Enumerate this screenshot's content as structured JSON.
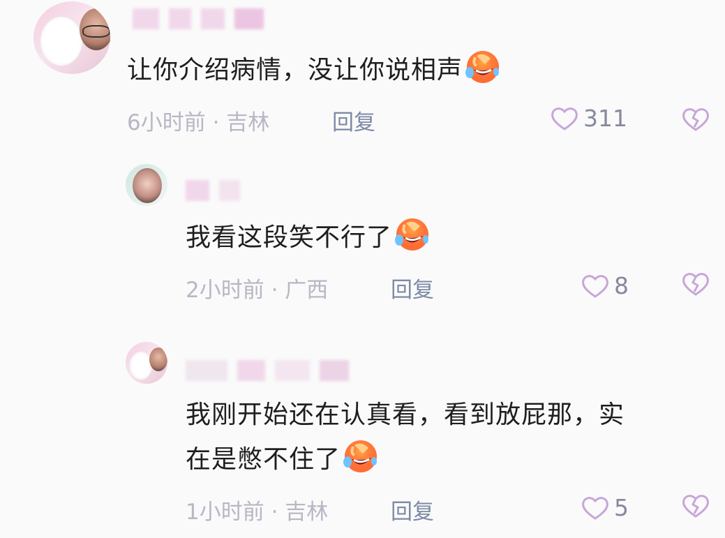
{
  "colors": {
    "background": "#fafafa",
    "text": "#1e1e1e",
    "meta": "#b7b7c5",
    "reply": "#7d8aa6",
    "heart": "#c7a6d8"
  },
  "icons": [
    "laughing-emoji-icon",
    "heart-icon",
    "broken-heart-icon"
  ],
  "comments": [
    {
      "text": "让你介绍病情，没让你说相声",
      "time_location": "6小时前 · 吉林",
      "reply_label": "回复",
      "likes": "311"
    },
    {
      "text": "我看这段笑不行了",
      "time_location": "2小时前 · 广西",
      "reply_label": "回复",
      "likes": "8"
    },
    {
      "text_line1": "我刚开始还在认真看，看到放屁那，实",
      "text_line2": "在是憋不住了",
      "time_location": "1小时前 · 吉林",
      "reply_label": "回复",
      "likes": "5"
    }
  ]
}
